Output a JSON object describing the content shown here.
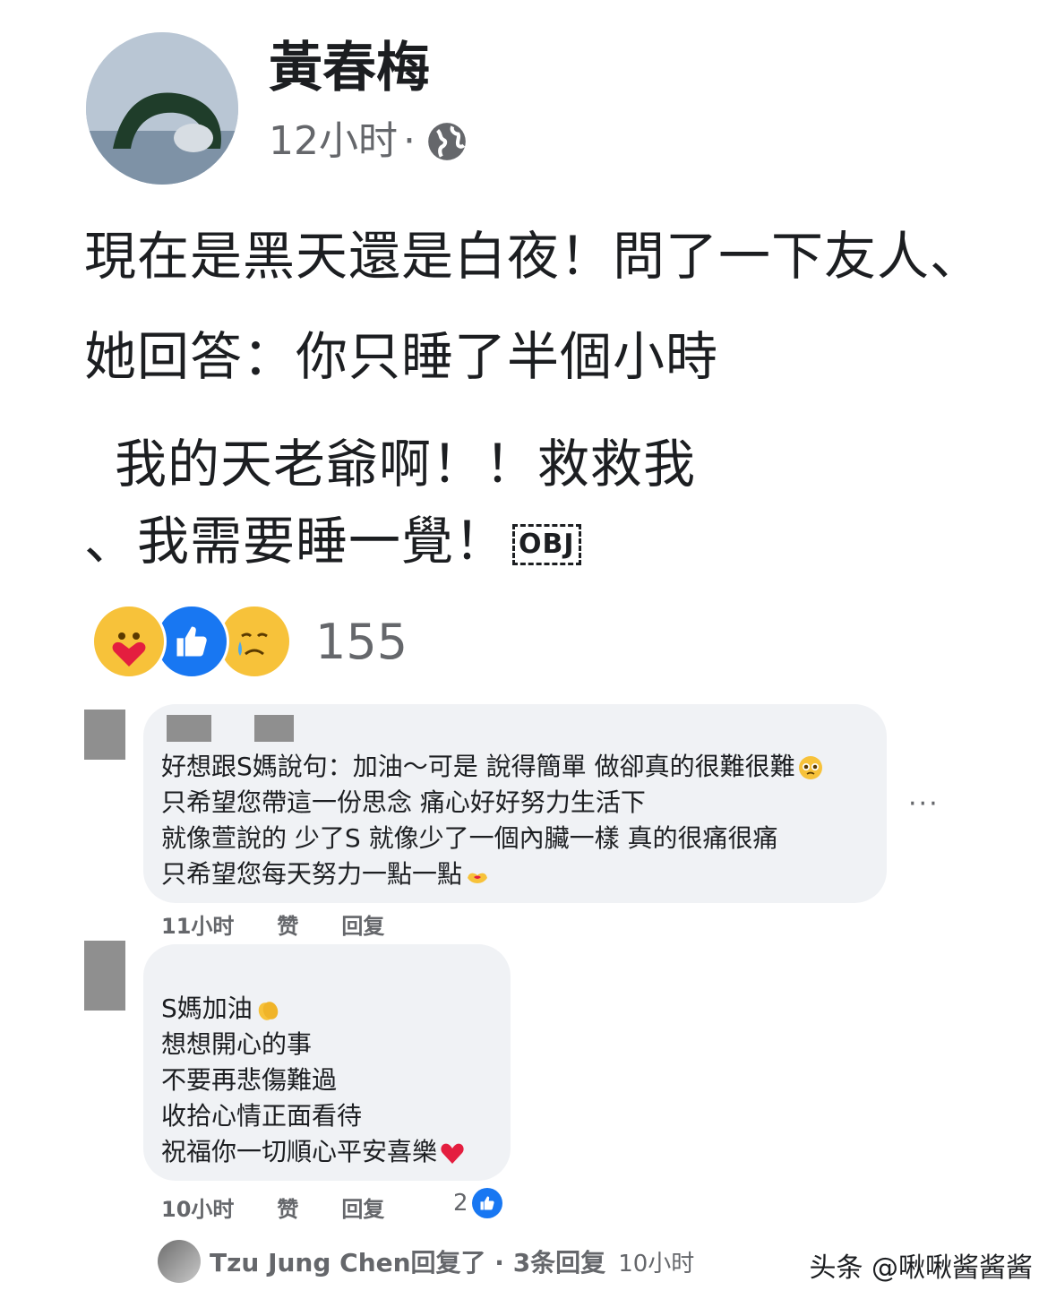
{
  "post": {
    "author": "黃春梅",
    "time": "12小时",
    "separator": "·",
    "audience_icon": "globe-icon",
    "lines": [
      "現在是黑天還是白夜！問了一下友人、",
      "她回答：你只睡了半個小時",
      "我的天老爺啊！！救救我",
      "、我需要睡一覺！"
    ],
    "obj_placeholder": "OBJ",
    "reactions": {
      "icons": [
        "care-reaction-icon",
        "like-reaction-icon",
        "sad-reaction-icon"
      ],
      "count": "155"
    }
  },
  "comments": [
    {
      "lines": [
        "好想跟S媽說句：加油～可是 說得簡單 做卻真的很難很難",
        "只希望您帶這一份思念 痛心好好努力生活下",
        "就像萱說的 少了S 就像少了一個內臟一樣 真的很痛很痛",
        "只希望您每天努力一點一點"
      ],
      "time": "11小时",
      "like_label": "赞",
      "reply_label": "回复",
      "more_icon": "more-options-icon",
      "more_label": "···"
    },
    {
      "lines": [
        "S媽加油",
        "想想開心的事",
        "不要再悲傷難過",
        "收拾心情正面看待",
        "祝福你一切順心平安喜樂"
      ],
      "time": "10小时",
      "like_label": "赞",
      "reply_label": "回复",
      "like_count": "2"
    }
  ],
  "replies": {
    "text": "Tzu Jung Chen回复了 · 3条回复",
    "time": "10小时"
  },
  "watermark": "头条 @啾啾酱酱酱",
  "colors": {
    "like_blue": "#1877f2",
    "bubble_gray": "#f0f2f5",
    "meta_gray": "#65676b",
    "heart_red": "#e41e3f"
  }
}
